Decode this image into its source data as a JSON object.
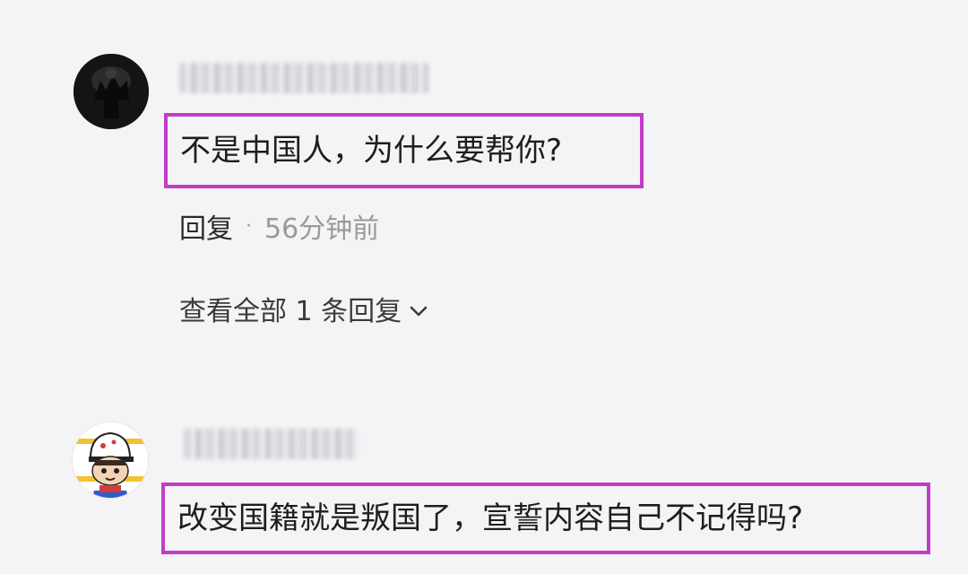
{
  "comments": [
    {
      "username": "",
      "text": "不是中国人，为什么要帮你?",
      "reply_label": "回复",
      "separator": "·",
      "time": "56分钟前",
      "view_replies": "查看全部 1 条回复",
      "avatar_icon": "dark-silhouette-avatar"
    },
    {
      "username": "",
      "text": "改变国籍就是叛国了，宣誓内容自己不记得吗?",
      "avatar_icon": "cartoon-boy-cap-avatar"
    }
  ],
  "colors": {
    "highlight_border": "#c23cc8",
    "background": "#f4f4f6",
    "muted_text": "#9a9a9a"
  }
}
